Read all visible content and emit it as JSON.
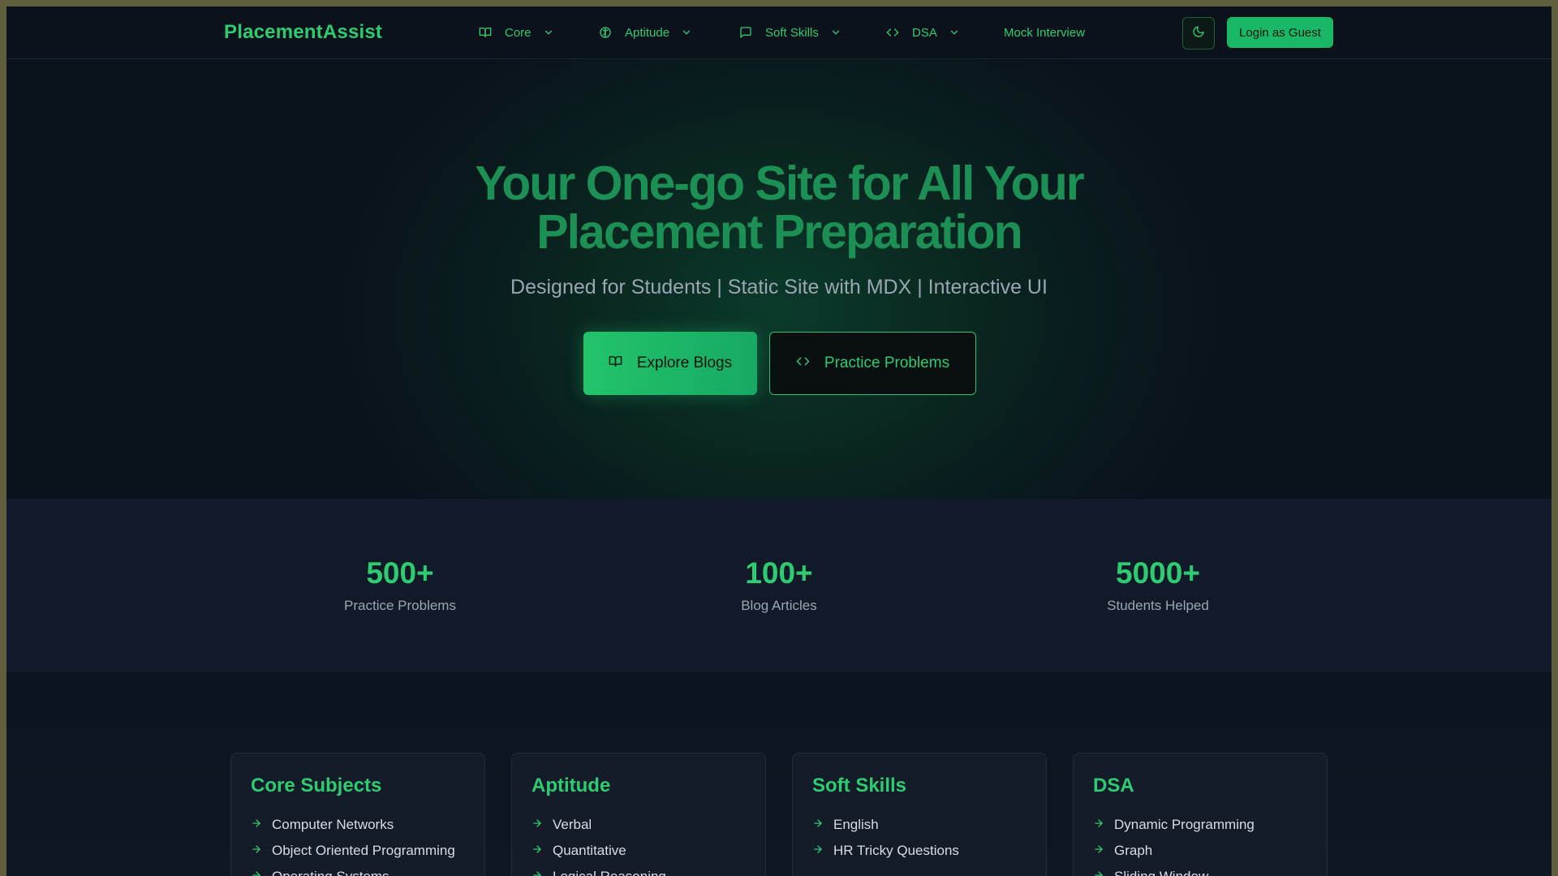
{
  "nav": {
    "brand": "PlacementAssist",
    "items": [
      {
        "label": "Core",
        "icon": "book-open-icon"
      },
      {
        "label": "Aptitude",
        "icon": "brain-icon"
      },
      {
        "label": "Soft Skills",
        "icon": "message-square-icon"
      },
      {
        "label": "DSA",
        "icon": "code-icon"
      }
    ],
    "mock_interview": "Mock Interview",
    "theme_icon": "moon-icon",
    "login_label": "Login as Guest"
  },
  "hero": {
    "title_line1": "Your One-go Site for All Your",
    "title_line2": "Placement Preparation",
    "subtitle": "Designed for Students | Static Site with MDX | Interactive UI",
    "primary_button": "Explore Blogs",
    "secondary_button": "Practice Problems"
  },
  "stats": [
    {
      "value": "500+",
      "label": "Practice Problems"
    },
    {
      "value": "100+",
      "label": "Blog Articles"
    },
    {
      "value": "5000+",
      "label": "Students Helped"
    }
  ],
  "cards": [
    {
      "title": "Core Subjects",
      "items": [
        "Computer Networks",
        "Object Oriented Programming",
        "Operating Systems"
      ]
    },
    {
      "title": "Aptitude",
      "items": [
        "Verbal",
        "Quantitative",
        "Logical Reasoning"
      ]
    },
    {
      "title": "Soft Skills",
      "items": [
        "English",
        "HR Tricky Questions"
      ]
    },
    {
      "title": "DSA",
      "items": [
        "Dynamic Programming",
        "Graph",
        "Sliding Window"
      ]
    }
  ],
  "colors": {
    "accent": "#2ecc71",
    "background": "#0f1623",
    "hero_title": "#1c8f55"
  }
}
